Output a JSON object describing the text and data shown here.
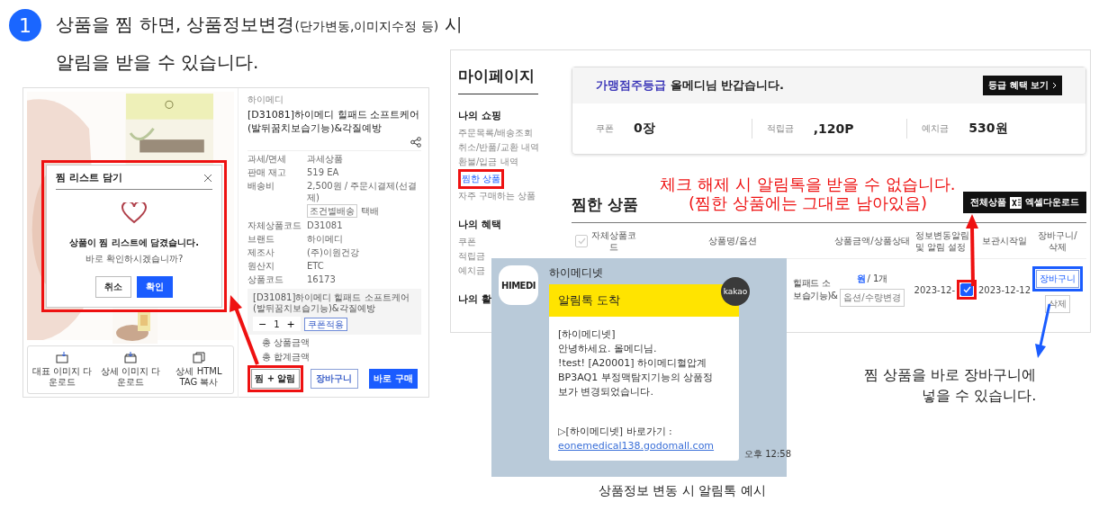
{
  "step": {
    "number": "1",
    "line1": "상품을 찜 하면, 상품정보변경",
    "line1_small": "(단가변동,이미지수정 등)",
    "line1_end": "시",
    "line2": "알림을 받을 수 있습니다."
  },
  "product_page": {
    "modal": {
      "title": "찜 리스트 담기",
      "message": "상품이 찜 리스트에 담겼습니다.",
      "question": "바로 확인하시겠습니까?",
      "highlighted": true,
      "buttons": [
        {
          "label": "취소",
          "kind": "secondary"
        },
        {
          "label": "확인",
          "kind": "primary"
        }
      ]
    },
    "downloads": [
      {
        "label": "대표 이미지 다운로드",
        "kind": "single"
      },
      {
        "label": "상세 이미지 다운로드",
        "kind": "multi"
      },
      {
        "label": "상세 HTML TAG 복사",
        "kind": "copy"
      }
    ],
    "brand": "하이메디",
    "title": "[D31081]하이메디 힐패드 소프트케어(발뒤꿈치보습기능)&각질예방",
    "info": [
      {
        "label": "과세/면세",
        "value": "과세상품"
      },
      {
        "label": "판매 재고",
        "value": "519 EA"
      },
      {
        "label": "배송비",
        "value": "2,500원 / 주문시결제(선결제)",
        "tag": "조건별배송",
        "note": "택배"
      },
      {
        "label": "자체상품코드",
        "value": "D31081"
      },
      {
        "label": "브랜드",
        "value": "하이메디"
      },
      {
        "label": "제조사",
        "value": "(주)이원건강"
      },
      {
        "label": "원산지",
        "value": "ETC"
      },
      {
        "label": "상품코드",
        "value": "16173"
      }
    ],
    "option": {
      "name": "[D31081]하이메디 힐패드 소프트케어(발뒤꿈치보습기능)&각질예방",
      "minus": "−",
      "quantity": "1",
      "plus": "+",
      "coupon": "쿠폰적용"
    },
    "totals": [
      "총 상품금액",
      "총 합계금액"
    ],
    "buttons": [
      {
        "label": "찜 + 알림",
        "kind": "outline",
        "highlighted": true
      },
      {
        "label": "장바구니",
        "kind": "secondary",
        "highlighted": false
      },
      {
        "label": "바로 구매",
        "kind": "primary",
        "highlighted": false
      }
    ]
  },
  "mypage": {
    "title": "마이페이지",
    "sections": [
      {
        "heading": "나의 쇼핑",
        "items": [
          {
            "label": "주문목록/배송조회",
            "selected": false
          },
          {
            "label": "취소/반품/교환 내역",
            "selected": false
          },
          {
            "label": "환불/입금 내역",
            "selected": false
          },
          {
            "label": "찜한 상품",
            "selected": true
          },
          {
            "label": "자주 구매하는 상품",
            "selected": false
          }
        ]
      },
      {
        "heading": "나의 혜택",
        "items": [
          {
            "label": "쿠폰",
            "selected": false
          },
          {
            "label": "적립금",
            "selected": false
          },
          {
            "label": "예치금",
            "selected": false
          }
        ]
      },
      {
        "heading": "나의 활"
      }
    ],
    "welcome": {
      "grade": "가맹점주등급",
      "message": "올메디님 반갑습니다.",
      "button": "등급 혜택 보기"
    },
    "stats": [
      {
        "label": "쿠폰",
        "value": "0장"
      },
      {
        "label": "적립금",
        "value": ",120P"
      },
      {
        "label": "예치금",
        "value": "530원"
      }
    ],
    "notice": [
      "체크 해제 시 알림톡을 받을 수 없습니다.",
      "(찜한 상품에는 그대로 남아있음)"
    ],
    "heading": "찜한 상품",
    "excel_button": {
      "before": "전체상품",
      "after": "엑셀다운로드"
    },
    "all_checked": false,
    "columns": [
      "자체상품코드",
      "상품명/옵션",
      "상품금액/상품상태",
      "정보변동알림 및 알림 설정",
      "보관시작일",
      "장바구니/ 삭제"
    ],
    "rows": [
      {
        "name": [
          "힐패드 소",
          "보습기능)&"
        ],
        "price": "원",
        "quantity": "/ 1개",
        "option_button": "옵션/수량변경",
        "changed": "2023-12-",
        "alert_on": true,
        "stored": "2023-12-12",
        "cart_button": "장바구니",
        "delete_button": "삭제"
      }
    ]
  },
  "cart_tip": [
    "찜 상품을 바로 장바구니에",
    "넣을 수 있습니다."
  ],
  "kakao": {
    "logo": "HIMEDI",
    "sender": "하이메디넷",
    "header": "알림톡 도착",
    "badge": "kakao",
    "lines": [
      "[하이메디넷]",
      "안녕하세요. 올메디님.",
      "!test! [A20001] 하이메디혈압계",
      "BP3AQ1 부정맥탐지기능의 상품정",
      "보가 변경되었습니다."
    ],
    "link_prefix": "▷[하이메디넷] 바로가기 :",
    "link": "eonemedical138.godomall.com",
    "time": "오후 12:58"
  },
  "caption": "상품정보 변동 시 알림톡 예시"
}
